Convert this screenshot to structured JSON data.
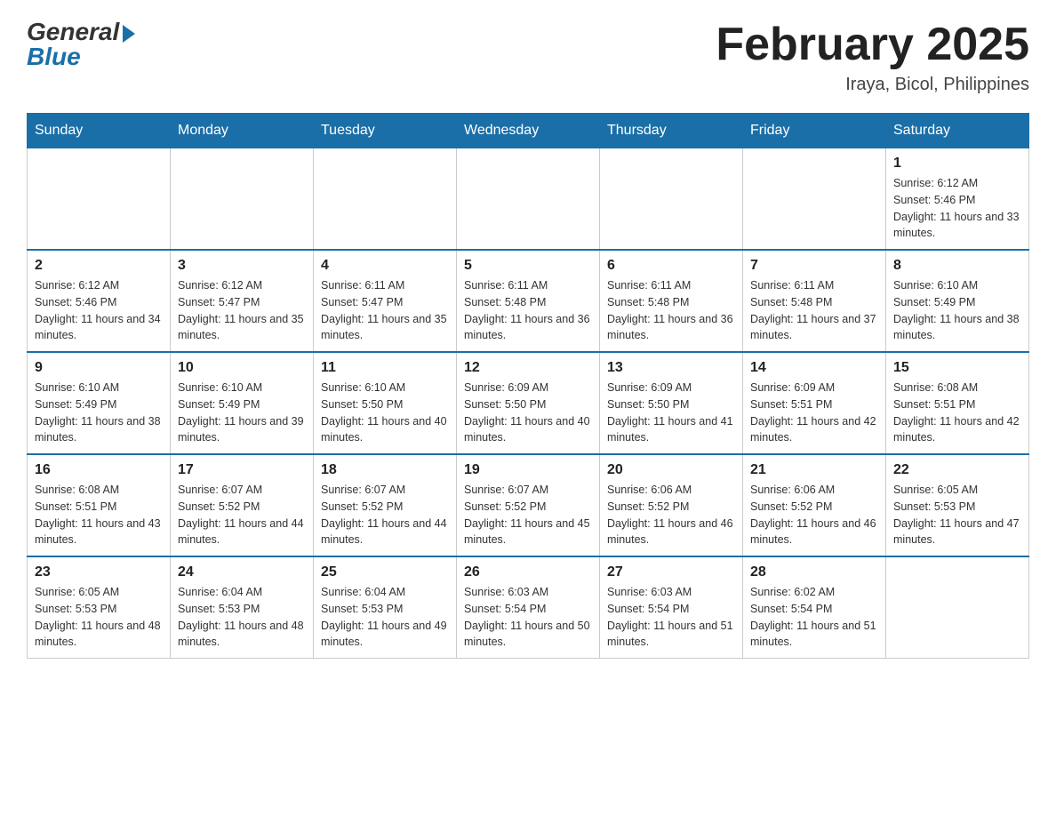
{
  "header": {
    "logo_general": "General",
    "logo_blue": "Blue",
    "month_title": "February 2025",
    "location": "Iraya, Bicol, Philippines"
  },
  "days_of_week": [
    "Sunday",
    "Monday",
    "Tuesday",
    "Wednesday",
    "Thursday",
    "Friday",
    "Saturday"
  ],
  "weeks": [
    {
      "days": [
        {
          "number": "",
          "info": ""
        },
        {
          "number": "",
          "info": ""
        },
        {
          "number": "",
          "info": ""
        },
        {
          "number": "",
          "info": ""
        },
        {
          "number": "",
          "info": ""
        },
        {
          "number": "",
          "info": ""
        },
        {
          "number": "1",
          "info": "Sunrise: 6:12 AM\nSunset: 5:46 PM\nDaylight: 11 hours and 33 minutes."
        }
      ]
    },
    {
      "days": [
        {
          "number": "2",
          "info": "Sunrise: 6:12 AM\nSunset: 5:46 PM\nDaylight: 11 hours and 34 minutes."
        },
        {
          "number": "3",
          "info": "Sunrise: 6:12 AM\nSunset: 5:47 PM\nDaylight: 11 hours and 35 minutes."
        },
        {
          "number": "4",
          "info": "Sunrise: 6:11 AM\nSunset: 5:47 PM\nDaylight: 11 hours and 35 minutes."
        },
        {
          "number": "5",
          "info": "Sunrise: 6:11 AM\nSunset: 5:48 PM\nDaylight: 11 hours and 36 minutes."
        },
        {
          "number": "6",
          "info": "Sunrise: 6:11 AM\nSunset: 5:48 PM\nDaylight: 11 hours and 36 minutes."
        },
        {
          "number": "7",
          "info": "Sunrise: 6:11 AM\nSunset: 5:48 PM\nDaylight: 11 hours and 37 minutes."
        },
        {
          "number": "8",
          "info": "Sunrise: 6:10 AM\nSunset: 5:49 PM\nDaylight: 11 hours and 38 minutes."
        }
      ]
    },
    {
      "days": [
        {
          "number": "9",
          "info": "Sunrise: 6:10 AM\nSunset: 5:49 PM\nDaylight: 11 hours and 38 minutes."
        },
        {
          "number": "10",
          "info": "Sunrise: 6:10 AM\nSunset: 5:49 PM\nDaylight: 11 hours and 39 minutes."
        },
        {
          "number": "11",
          "info": "Sunrise: 6:10 AM\nSunset: 5:50 PM\nDaylight: 11 hours and 40 minutes."
        },
        {
          "number": "12",
          "info": "Sunrise: 6:09 AM\nSunset: 5:50 PM\nDaylight: 11 hours and 40 minutes."
        },
        {
          "number": "13",
          "info": "Sunrise: 6:09 AM\nSunset: 5:50 PM\nDaylight: 11 hours and 41 minutes."
        },
        {
          "number": "14",
          "info": "Sunrise: 6:09 AM\nSunset: 5:51 PM\nDaylight: 11 hours and 42 minutes."
        },
        {
          "number": "15",
          "info": "Sunrise: 6:08 AM\nSunset: 5:51 PM\nDaylight: 11 hours and 42 minutes."
        }
      ]
    },
    {
      "days": [
        {
          "number": "16",
          "info": "Sunrise: 6:08 AM\nSunset: 5:51 PM\nDaylight: 11 hours and 43 minutes."
        },
        {
          "number": "17",
          "info": "Sunrise: 6:07 AM\nSunset: 5:52 PM\nDaylight: 11 hours and 44 minutes."
        },
        {
          "number": "18",
          "info": "Sunrise: 6:07 AM\nSunset: 5:52 PM\nDaylight: 11 hours and 44 minutes."
        },
        {
          "number": "19",
          "info": "Sunrise: 6:07 AM\nSunset: 5:52 PM\nDaylight: 11 hours and 45 minutes."
        },
        {
          "number": "20",
          "info": "Sunrise: 6:06 AM\nSunset: 5:52 PM\nDaylight: 11 hours and 46 minutes."
        },
        {
          "number": "21",
          "info": "Sunrise: 6:06 AM\nSunset: 5:52 PM\nDaylight: 11 hours and 46 minutes."
        },
        {
          "number": "22",
          "info": "Sunrise: 6:05 AM\nSunset: 5:53 PM\nDaylight: 11 hours and 47 minutes."
        }
      ]
    },
    {
      "days": [
        {
          "number": "23",
          "info": "Sunrise: 6:05 AM\nSunset: 5:53 PM\nDaylight: 11 hours and 48 minutes."
        },
        {
          "number": "24",
          "info": "Sunrise: 6:04 AM\nSunset: 5:53 PM\nDaylight: 11 hours and 48 minutes."
        },
        {
          "number": "25",
          "info": "Sunrise: 6:04 AM\nSunset: 5:53 PM\nDaylight: 11 hours and 49 minutes."
        },
        {
          "number": "26",
          "info": "Sunrise: 6:03 AM\nSunset: 5:54 PM\nDaylight: 11 hours and 50 minutes."
        },
        {
          "number": "27",
          "info": "Sunrise: 6:03 AM\nSunset: 5:54 PM\nDaylight: 11 hours and 51 minutes."
        },
        {
          "number": "28",
          "info": "Sunrise: 6:02 AM\nSunset: 5:54 PM\nDaylight: 11 hours and 51 minutes."
        },
        {
          "number": "",
          "info": ""
        }
      ]
    }
  ]
}
